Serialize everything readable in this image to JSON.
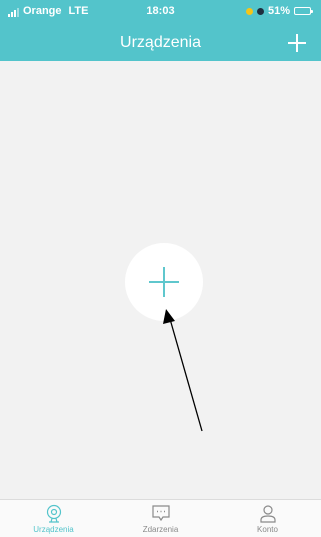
{
  "status_bar": {
    "carrier": "Orange",
    "network": "LTE",
    "time": "18:03",
    "battery": "51%",
    "battery_level": 0.51
  },
  "header": {
    "title": "Urządzenia",
    "add_icon": "plus-icon"
  },
  "main": {
    "add_device_icon": "plus-icon",
    "annotation": "arrow pointing to add button"
  },
  "tabs": [
    {
      "label": "Urządzenia",
      "icon": "camera-icon",
      "active": true
    },
    {
      "label": "Zdarzenia",
      "icon": "message-icon",
      "active": false
    },
    {
      "label": "Konto",
      "icon": "user-icon",
      "active": false
    }
  ],
  "colors": {
    "accent": "#53c4cb",
    "background": "#f2f2f2",
    "inactive": "#8a8a8a"
  }
}
